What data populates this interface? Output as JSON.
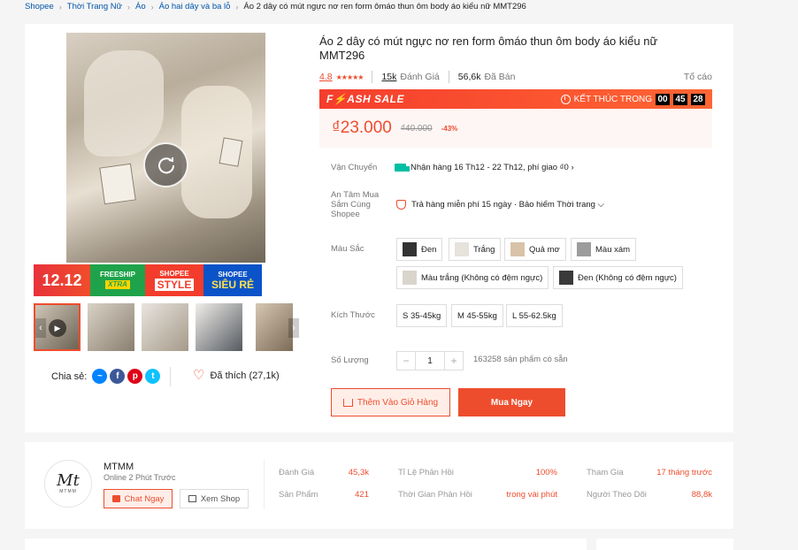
{
  "breadcrumb": {
    "items": [
      "Shopee",
      "Thời Trang Nữ",
      "Áo",
      "Áo hai dây và ba lỗ"
    ],
    "current": "Áo 2 dây có mút ngực nơ ren form ômáo thun ôm body áo kiểu nữ MMT296"
  },
  "gallery": {
    "promo": {
      "sale_day": "12.12",
      "freeship": "FREESHIP",
      "xtra": "XTRA",
      "shopee": "SHOPEE",
      "style": "STYLE",
      "shopee2": "SHOPEE",
      "sieu_re": "SIÊU RẺ"
    }
  },
  "share": {
    "label": "Chia sẻ:",
    "networks": [
      "messenger",
      "facebook",
      "pinterest",
      "twitter"
    ]
  },
  "likes": {
    "label": "Đã thích (27,1k)"
  },
  "product": {
    "title": "Áo 2 dây có mút ngực nơ ren form ômáo thun ôm body áo kiểu nữ MMT296",
    "rating": "4.8",
    "stars": 5,
    "reviews_count": "15k",
    "reviews_label": "Đánh Giá",
    "sold_count": "56,6k",
    "sold_label": "Đã Bán",
    "report": "Tố cáo"
  },
  "flash_sale": {
    "title": "F⚡ASH SALE",
    "ends_label": "KẾT THÚC TRONG",
    "hours": "00",
    "minutes": "45",
    "seconds": "28"
  },
  "price": {
    "current": "₫23.000",
    "original": "₫40.000",
    "discount": "-43%"
  },
  "shipping": {
    "label": "Vận Chuyển",
    "text": "Nhận hàng 16 Th12 - 22 Th12, phí giao ₫0 ›"
  },
  "assurance": {
    "label": "An Tâm Mua Sắm Cùng Shopee",
    "text": "Trả hàng miễn phí 15 ngày · Bảo hiểm Thời trang ⌵"
  },
  "colors": {
    "label": "Màu Sắc",
    "options": [
      "Đen",
      "Trắng",
      "Quả mơ",
      "Màu xám",
      "Màu trắng (Không có đệm ngực)",
      "Đen (Không có đệm ngực)"
    ]
  },
  "sizes": {
    "label": "Kích Thước",
    "options": [
      "S 35-45kg",
      "M 45-55kg",
      "L 55-62.5kg"
    ]
  },
  "quantity": {
    "label": "Số Lượng",
    "minus": "−",
    "value": "1",
    "plus": "+",
    "stock": "163258 sản phẩm có sẵn"
  },
  "actions": {
    "add_to_cart": "Thêm Vào Giỏ Hàng",
    "buy_now": "Mua Ngay"
  },
  "shop": {
    "logo_text": "Mt",
    "logo_sub": "MTMM",
    "name": "MTMM",
    "online": "Online 2 Phút Trước",
    "chat": "Chat Ngay",
    "view_shop": "Xem Shop",
    "stats": {
      "ratings_label": "Đánh Giá",
      "ratings_value": "45,3k",
      "products_label": "Sản Phẩm",
      "products_value": "421",
      "response_rate_label": "Tỉ Lệ Phản Hồi",
      "response_rate_value": "100%",
      "response_time_label": "Thời Gian Phản Hồi",
      "response_time_value": "trong vài phút",
      "joined_label": "Tham Gia",
      "joined_value": "17 tháng trước",
      "followers_label": "Người Theo Dõi",
      "followers_value": "88,8k"
    }
  },
  "colors_theme": {
    "accent": "#ee4d2d",
    "link": "#0055aa"
  }
}
